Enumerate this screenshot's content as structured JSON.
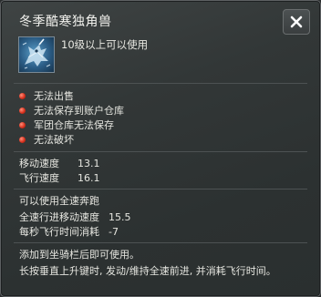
{
  "window": {
    "title": "冬季酷寒独角兽",
    "close_label": "✕"
  },
  "item": {
    "icon": "winter-unicorn-mount-icon",
    "requirement": "10级以上可以使用"
  },
  "restrictions": [
    "无法出售",
    "无法保存到账户仓库",
    "军团仓库无法保存",
    "无法破坏"
  ],
  "stats": [
    {
      "label": "移动速度",
      "value": "13.1"
    },
    {
      "label": "飞行速度",
      "value": "16.1"
    }
  ],
  "sprint": {
    "title": "可以使用全速奔跑",
    "lines": [
      {
        "label": "全速行进移动速度",
        "value": "15.5"
      },
      {
        "label": "每秒飞行时间消耗",
        "value": "-7"
      }
    ]
  },
  "description": [
    "添加到坐骑栏后即可使用。",
    "长按垂直上升键时, 发动/维持全速前进, 并消耗飞行时间。"
  ],
  "colors": {
    "restriction_dot": "#d8321f",
    "background": "#323737",
    "text": "#e6e6e0"
  }
}
